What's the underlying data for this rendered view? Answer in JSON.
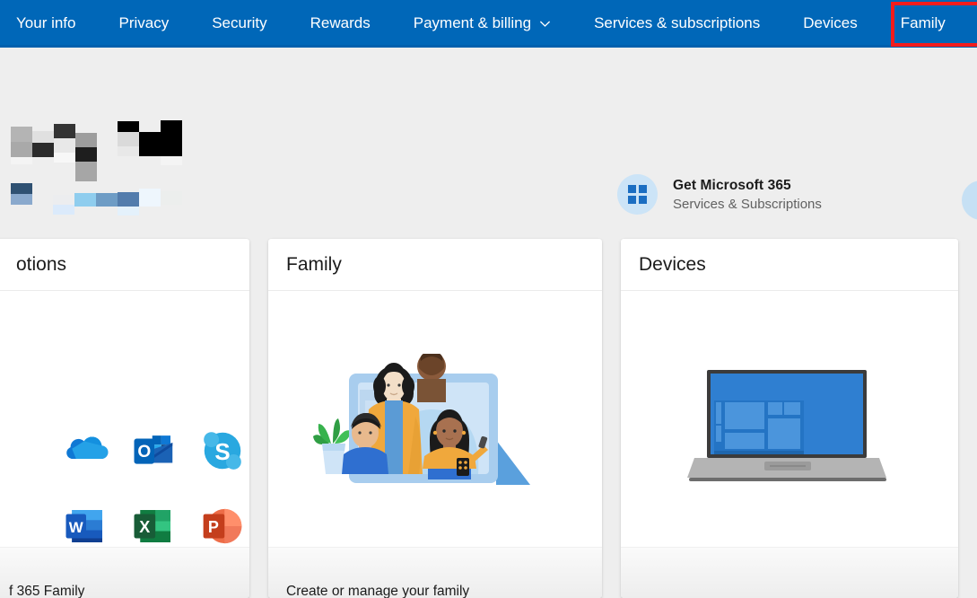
{
  "nav": {
    "items": [
      {
        "label": "Your info",
        "icon": null,
        "highlighted": false
      },
      {
        "label": "Privacy",
        "icon": null,
        "highlighted": false
      },
      {
        "label": "Security",
        "icon": null,
        "highlighted": false
      },
      {
        "label": "Rewards",
        "icon": null,
        "highlighted": false
      },
      {
        "label": "Payment & billing",
        "icon": "chevron-down-icon",
        "highlighted": false
      },
      {
        "label": "Services & subscriptions",
        "icon": null,
        "highlighted": false
      },
      {
        "label": "Devices",
        "icon": null,
        "highlighted": false
      },
      {
        "label": "Family",
        "icon": null,
        "highlighted": true
      }
    ],
    "background_color": "#0067b8",
    "text_color": "#ffffff",
    "highlight_color": "#f41c1c"
  },
  "account_strip": {
    "user_name_redacted": true,
    "user_email_redacted": true,
    "promo": {
      "title": "Get Microsoft 365",
      "subtitle": "Services & Subscriptions",
      "icon": "windows-logo-icon",
      "icon_bg": "#cce4f7",
      "icon_color": "#1b6ec2"
    }
  },
  "cards": [
    {
      "id": "subscriptions",
      "title": "otions",
      "full_title": "Services & subscriptions",
      "illustration": "office-apps-icons",
      "apps": [
        {
          "name": "onedrive-icon",
          "label": "OneDrive"
        },
        {
          "name": "outlook-icon",
          "label": "Outlook"
        },
        {
          "name": "skype-icon",
          "label": "Skype"
        },
        {
          "name": "word-icon",
          "label": "Word"
        },
        {
          "name": "excel-icon",
          "label": "Excel"
        },
        {
          "name": "powerpoint-icon",
          "label": "PowerPoint"
        }
      ],
      "footer_text": "f 365 Family"
    },
    {
      "id": "family",
      "title": "Family",
      "illustration": "family-on-laptop-illustration",
      "footer_text": "Create or manage your family"
    },
    {
      "id": "devices",
      "title": "Devices",
      "illustration": "laptop-illustration",
      "footer_text": ""
    }
  ],
  "colors": {
    "page_background": "#eeeeee",
    "card_background": "#ffffff",
    "accent_blue": "#0067b8",
    "text_primary": "#1b1b1b",
    "text_secondary": "#616161"
  }
}
